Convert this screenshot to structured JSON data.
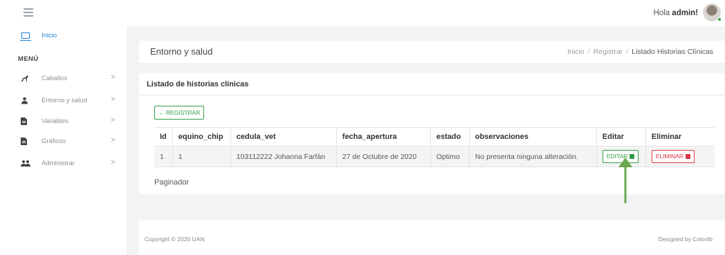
{
  "header": {
    "greeting_prefix": "Hola ",
    "username": "admin!"
  },
  "sidebar": {
    "home_label": "Inicio",
    "menu_heading": "MENÚ",
    "items": [
      {
        "label": "Caballos",
        "icon": "horse-icon"
      },
      {
        "label": "Entorno y salud",
        "icon": "user-icon"
      },
      {
        "label": "Variables",
        "icon": "file-icon"
      },
      {
        "label": "Gráficos",
        "icon": "file-icon"
      },
      {
        "label": "Administrar",
        "icon": "users-icon"
      }
    ],
    "chevron": ">"
  },
  "page": {
    "title": "Entorno y salud",
    "breadcrumb": [
      "Inicio",
      "Registrar",
      "Listado Historias Clínicas"
    ],
    "breadcrumb_sep": "/"
  },
  "card": {
    "title": "Listado de historias clinicas",
    "register_button": "← REGISTRAR"
  },
  "table": {
    "columns": [
      "Id",
      "equino_chip",
      "cedula_vet",
      "fecha_apertura",
      "estado",
      "observaciones",
      "Editar",
      "Eliminar"
    ],
    "rows": [
      {
        "id": "1",
        "equino_chip": "1",
        "cedula_vet": "103112222 Johanna Farfán",
        "fecha_apertura": "27 de Octubre de 2020",
        "estado": "Optimo",
        "observaciones": "No presenta ninguna alteración.",
        "edit_label": "EDITAR",
        "delete_label": "ELIMINAR"
      }
    ]
  },
  "paginator_label": "Paginador",
  "footer": {
    "copyright": "Copyright © 2020 UAN",
    "designed_by": "Designed by Colorlib"
  },
  "colors": {
    "accent": "#1d7fd6",
    "success": "#2f9e44",
    "danger": "#dc3545",
    "annotation_arrow": "#6aa84f"
  }
}
